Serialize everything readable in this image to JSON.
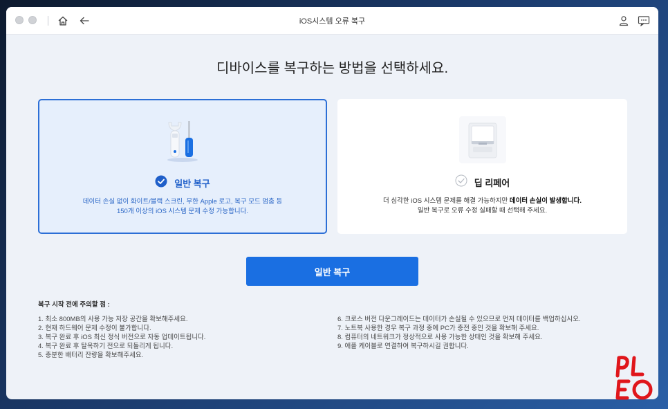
{
  "window": {
    "title": "iOS시스템 오류 복구"
  },
  "toolbar": {
    "icons": [
      "home-icon",
      "back-arrow-icon",
      "user-icon",
      "feedback-icon"
    ]
  },
  "headline": "디바이스를 복구하는 방법을 선택하세요.",
  "modes": [
    {
      "title": "일반 복구",
      "selected": true,
      "icon": "tools-icon",
      "desc_line1": "데이터 손실 없이 화이트/블랙 스크린, 무한 Apple 로고, 복구 모드 멈춤 등",
      "desc_line2": "150개 이상의 iOS 시스템 문제  수정 가능합니다."
    },
    {
      "title": "딥 리페어",
      "selected": false,
      "icon": "phone-box-icon",
      "desc_line1_a": "더 심각한 iOS 시스템 문제를 해결 가능하지만 ",
      "desc_line1_b": "데이터 손실이 발생합니다.",
      "desc_line2": "일반 복구로 오류 수정 실패할 때 선택해 주세요."
    }
  ],
  "primary_button": "일반 복구",
  "notes": {
    "title": "복구 시작 전에 주의할 점 :",
    "left": [
      "1. 최소 800MB의 사용 가능 저장 공간을 확보해주세요.",
      "2. 현재 하드웨어 문제 수정이 불가합니다.",
      "3. 복구 완료 후 iOS 최신 정식 버전으로 자동 업데이트됩니다.",
      "4. 복구 완료 후 탈옥하기 전으로 되돌리게 됩니다.",
      "5. 충분한 배터리 잔량을 확보해주세요."
    ],
    "right": [
      "6. 크로스 버전 다운그레이드는 데이터가 손실될 수 있으므로 먼저 데이터를 백업하십시오.",
      "7. 노트북 사용한 경우 복구 과정 중에 PC가 충전 중인 것을 확보해 주세요.",
      "8. 컴퓨터의 네트워크가 정상적으로 사용 가능한 상태인 것을 확보해 주세요.",
      "9. 애플 케이블로 연결하여 복구하시길 권합니다."
    ]
  },
  "watermark": {
    "text": "PLEO",
    "color": "#e0161b"
  },
  "colors": {
    "accent": "#1a6fe2",
    "selected_border": "#2c6fd6",
    "selected_bg": "#e6effc"
  }
}
